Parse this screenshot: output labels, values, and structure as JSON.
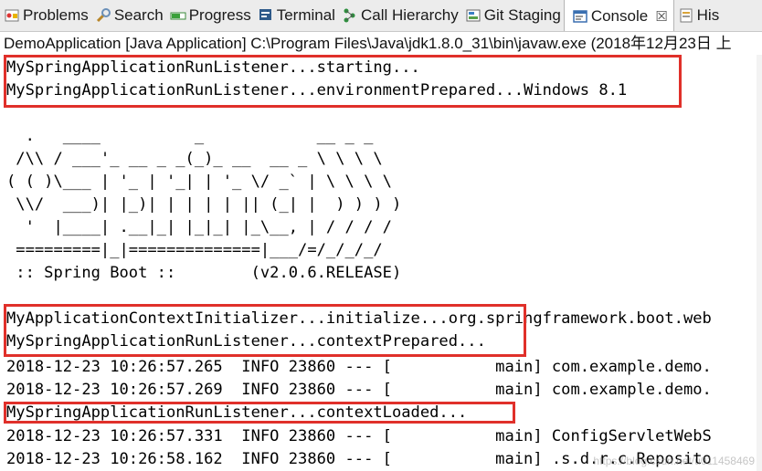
{
  "tabs": [
    {
      "label": "Problems",
      "icon": "problems-icon",
      "active": false
    },
    {
      "label": "Search",
      "icon": "search-icon",
      "active": false
    },
    {
      "label": "Progress",
      "icon": "progress-icon",
      "active": false
    },
    {
      "label": "Terminal",
      "icon": "terminal-icon",
      "active": false
    },
    {
      "label": "Call Hierarchy",
      "icon": "call-hierarchy-icon",
      "active": false
    },
    {
      "label": "Git Staging",
      "icon": "git-staging-icon",
      "active": false
    },
    {
      "label": "Console",
      "icon": "console-icon",
      "active": true,
      "close": "☒"
    },
    {
      "label": "His",
      "icon": "history-icon",
      "active": false
    }
  ],
  "console_description": "DemoApplication [Java Application] C:\\Program Files\\Java\\jdk1.8.0_31\\bin\\javaw.exe (2018年12月23日 上",
  "console_lines": [
    "MySpringApplicationRunListener...starting...",
    "MySpringApplicationRunListener...environmentPrepared...Windows 8.1",
    "",
    "  .   ____          _            __ _ _",
    " /\\\\ / ___'_ __ _ _(_)_ __  __ _ \\ \\ \\ \\",
    "( ( )\\___ | '_ | '_| | '_ \\/ _` | \\ \\ \\ \\",
    " \\\\/  ___)| |_)| | | | | || (_| |  ) ) ) )",
    "  '  |____| .__|_| |_|_| |_\\__, | / / / /",
    " =========|_|==============|___/=/_/_/_/",
    " :: Spring Boot ::        (v2.0.6.RELEASE)",
    "",
    "MyApplicationContextInitializer...initialize...org.springframework.boot.web",
    "MySpringApplicationRunListener...contextPrepared...",
    "2018-12-23 10:26:57.265  INFO 23860 --- [           main] com.example.demo.",
    "2018-12-23 10:26:57.269  INFO 23860 --- [           main] com.example.demo.",
    "MySpringApplicationRunListener...contextLoaded...",
    "2018-12-23 10:26:57.331  INFO 23860 --- [           main] ConfigServletWebS",
    "2018-12-23 10:26:58.162  INFO 23860 --- [           main] .s.d.r.c.Reposito"
  ],
  "watermark": "https://blog.csdn.net/u011458469",
  "colors": {
    "highlight": "#e0302a",
    "tabbar": "#ececec"
  }
}
